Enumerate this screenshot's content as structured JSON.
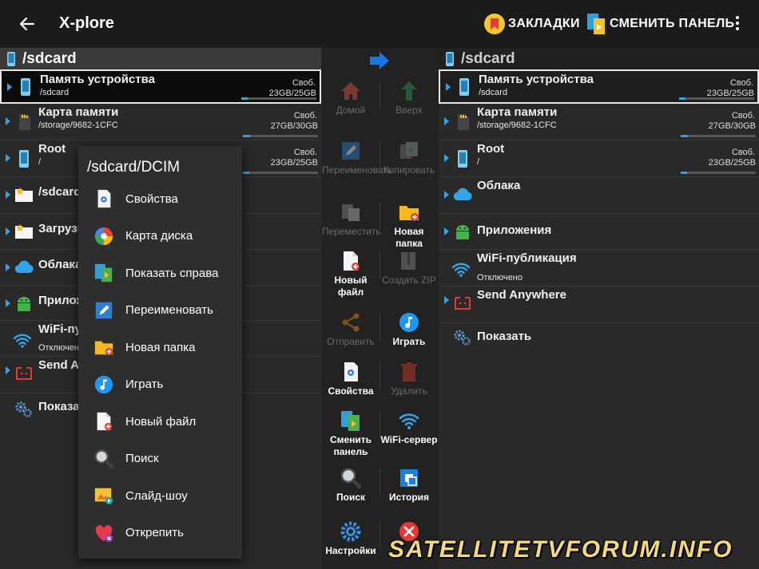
{
  "app": {
    "title": "X-plore"
  },
  "toolbar": {
    "bookmarks": "ЗАКЛАДКИ",
    "switch_panel": "СМЕНИТЬ ПАНЕЛЬ"
  },
  "left_panel": {
    "path": "/sdcard",
    "rows": [
      {
        "title": "Память устройства",
        "sub": "/sdcard",
        "free_label": "Своб.",
        "size": "23GB/25GB",
        "free_fraction": 0.08
      },
      {
        "title": "Карта памяти",
        "sub": "/storage/9682-1CFC",
        "free_label": "Своб.",
        "size": "27GB/30GB",
        "free_fraction": 0.1
      },
      {
        "title": "Root",
        "sub": "/",
        "free_label": "Своб.",
        "size": "23GB/25GB",
        "free_fraction": 0.08
      },
      {
        "title": "/sdcard/DCIM"
      },
      {
        "title": "Загрузки"
      },
      {
        "title": "Облака"
      },
      {
        "title": "Приложения"
      },
      {
        "title": "WiFi-публикация",
        "sub": "Отключено"
      },
      {
        "title": "Send Anywhere"
      },
      {
        "title": "Показать"
      }
    ]
  },
  "right_panel": {
    "path": "/sdcard",
    "rows": [
      {
        "title": "Память устройства",
        "sub": "/sdcard",
        "free_label": "Своб.",
        "size": "23GB/25GB",
        "free_fraction": 0.08
      },
      {
        "title": "Карта памяти",
        "sub": "/storage/9682-1CFC",
        "free_label": "Своб.",
        "size": "27GB/30GB",
        "free_fraction": 0.1
      },
      {
        "title": "Root",
        "sub": "/",
        "free_label": "Своб.",
        "size": "23GB/25GB",
        "free_fraction": 0.08
      },
      {
        "title": "Облака"
      },
      {
        "title": "Приложения"
      },
      {
        "title": "WiFi-публикация",
        "sub": "Отключено"
      },
      {
        "title": "Send Anywhere"
      },
      {
        "title": "Показать"
      }
    ]
  },
  "tools": [
    {
      "label": "Домой",
      "enabled": false,
      "icon": "home-icon"
    },
    {
      "label": "Вверх",
      "enabled": false,
      "icon": "up-arrow-icon"
    },
    {
      "label": "Переименовать",
      "enabled": false,
      "icon": "rename-icon"
    },
    {
      "label": "Копировать",
      "enabled": false,
      "icon": "copy-icon"
    },
    {
      "label": "Переместить",
      "enabled": false,
      "icon": "move-icon"
    },
    {
      "label": "Новая папка",
      "enabled": true,
      "icon": "new-folder-icon"
    },
    {
      "label": "Новый файл",
      "enabled": true,
      "icon": "new-file-icon"
    },
    {
      "label": "Создать ZIP",
      "enabled": false,
      "icon": "zip-icon"
    },
    {
      "label": "Отправить",
      "enabled": false,
      "icon": "share-icon"
    },
    {
      "label": "Играть",
      "enabled": true,
      "icon": "play-icon"
    },
    {
      "label": "Свойства",
      "enabled": true,
      "icon": "properties-icon"
    },
    {
      "label": "Удалить",
      "enabled": false,
      "icon": "trash-icon"
    },
    {
      "label": "Сменить панель",
      "enabled": true,
      "icon": "switch-panel-icon"
    },
    {
      "label": "WiFi-сервер",
      "enabled": true,
      "icon": "wifi-icon"
    },
    {
      "label": "Поиск",
      "enabled": true,
      "icon": "search-icon"
    },
    {
      "label": "История",
      "enabled": true,
      "icon": "history-icon"
    },
    {
      "label": "Настройки",
      "enabled": true,
      "icon": "settings-icon"
    },
    {
      "label": "",
      "enabled": true,
      "icon": "close-icon"
    }
  ],
  "context_menu": {
    "title": "/sdcard/DCIM",
    "items": [
      {
        "label": "Свойства",
        "icon": "properties-icon"
      },
      {
        "label": "Карта диска",
        "icon": "disk-map-icon"
      },
      {
        "label": "Показать справа",
        "icon": "show-right-icon"
      },
      {
        "label": "Переименовать",
        "icon": "rename-icon"
      },
      {
        "label": "Новая папка",
        "icon": "new-folder-icon"
      },
      {
        "label": "Играть",
        "icon": "play-icon"
      },
      {
        "label": "Новый файл",
        "icon": "new-file-icon"
      },
      {
        "label": "Поиск",
        "icon": "search-icon"
      },
      {
        "label": "Слайд-шоу",
        "icon": "slideshow-icon"
      },
      {
        "label": "Открепить",
        "icon": "unpin-heart-icon"
      }
    ]
  },
  "watermark": "SATELLITETVFORUM.INFO",
  "colors": {
    "accent_blue": "#35a4e6",
    "watermark": "#f2d97a",
    "folder_yellow": "#f7b820",
    "delete_red": "#e53935"
  }
}
